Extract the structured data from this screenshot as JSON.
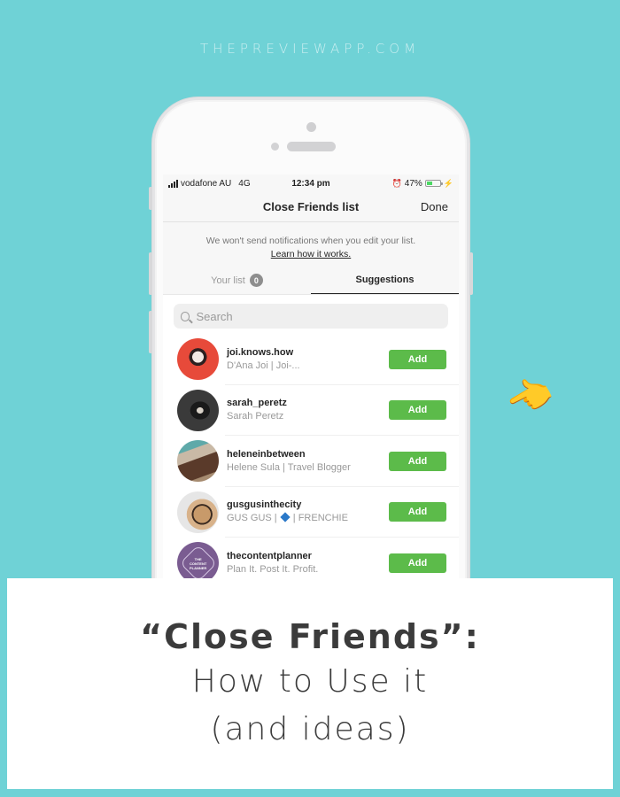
{
  "site_url": "THEPREVIEWAPP.COM",
  "status_bar": {
    "carrier": "vodafone AU",
    "network": "4G",
    "time": "12:34 pm",
    "battery_percent_label": "47%",
    "battery_level": 0.47,
    "battery_color": "#4cd964"
  },
  "nav": {
    "title": "Close Friends list",
    "done_label": "Done"
  },
  "notice": {
    "text": "We won't send notifications when you edit your list.",
    "link": "Learn how it works."
  },
  "tabs": [
    {
      "label": "Your list",
      "badge": "0",
      "active": false
    },
    {
      "label": "Suggestions",
      "active": true
    }
  ],
  "search": {
    "placeholder": "Search",
    "value": ""
  },
  "suggestions": [
    {
      "username": "joi.knows.how",
      "full_name": "D'Ana Joi | Joi-...",
      "action": "Add"
    },
    {
      "username": "sarah_peretz",
      "full_name": "Sarah Peretz",
      "action": "Add"
    },
    {
      "username": "heleneinbetween",
      "full_name": "Helene Sula | Travel Blogger",
      "action": "Add"
    },
    {
      "username": "gusgusinthecity",
      "full_name_pre": "GUS GUS |",
      "full_name_post": "| FRENCHIE",
      "action": "Add"
    },
    {
      "username": "thecontentplanner",
      "full_name": "Plan It. Post It. Profit.",
      "avatar_text": "THE CONTENT PLANNER",
      "action": "Add"
    }
  ],
  "decor": {
    "pointer_emoji": "👈"
  },
  "card": {
    "title": "“Close Friends”:",
    "line1": "How to Use it",
    "line2": "(and ideas)"
  },
  "colors": {
    "background": "#6fd2d6",
    "add_button": "#5cbb4a",
    "text_dark": "#3b3b3b"
  }
}
